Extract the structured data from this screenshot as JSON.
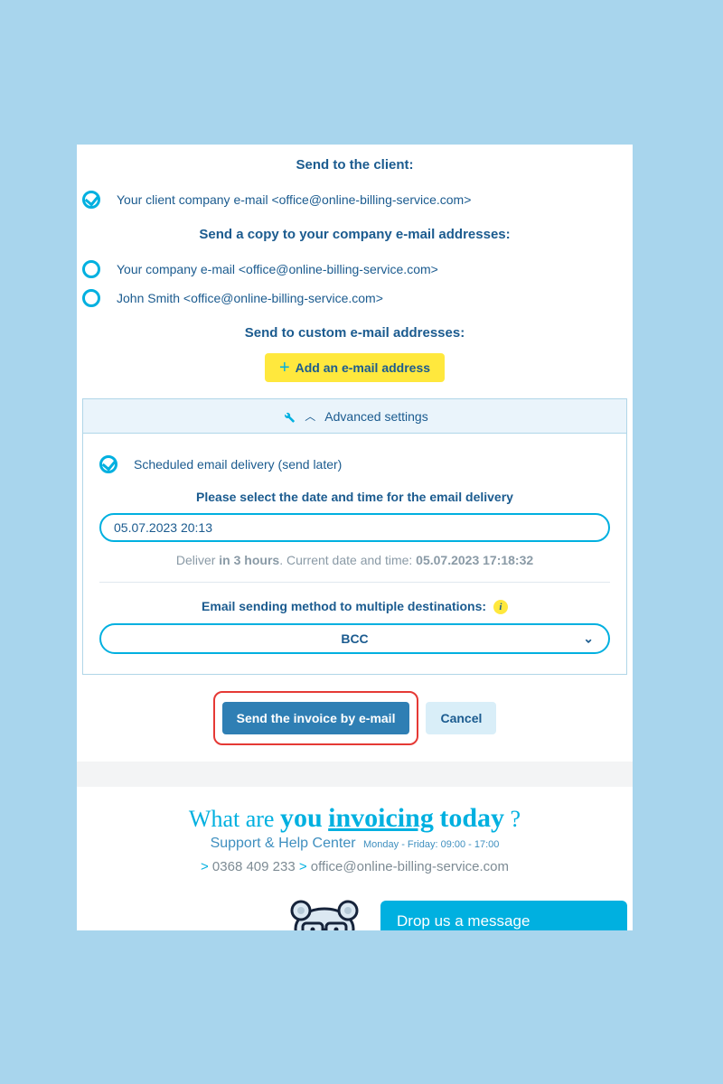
{
  "send_to_client_heading": "Send to the client:",
  "client_option": "Your client company e-mail <office@online-billing-service.com>",
  "send_copy_heading": "Send a copy to your company e-mail addresses:",
  "company_option": "Your company e-mail <office@online-billing-service.com>",
  "john_option": "John Smith <office@online-billing-service.com>",
  "custom_heading": "Send to custom e-mail addresses:",
  "add_email_label": "Add an e-mail address",
  "advanced_settings_label": "Advanced settings",
  "scheduled_option": "Scheduled email delivery (send later)",
  "date_heading": "Please select the date and time for the email delivery",
  "date_value": "05.07.2023 20:13",
  "deliver_prefix": "Deliver ",
  "deliver_bold1": "in 3 hours",
  "deliver_mid": ". Current date and time: ",
  "deliver_bold2": "05.07.2023 17:18:32",
  "method_label": "Email sending method to multiple destinations:",
  "method_value": "BCC",
  "send_button": "Send the invoice by e-mail",
  "cancel_button": "Cancel",
  "tagline_p1": "What are ",
  "tagline_you": "you",
  "tagline_sp": " ",
  "tagline_inv": "invoicing",
  "tagline_sp2": " ",
  "tagline_today": "today",
  "tagline_q": " ?",
  "support_label": "Support & Help Center",
  "support_hours": "Monday - Friday: 09:00 - 17:00",
  "phone": "0368 409 233",
  "email": "office@online-billing-service.com",
  "chev": ">",
  "chat_label": "Drop us a message"
}
